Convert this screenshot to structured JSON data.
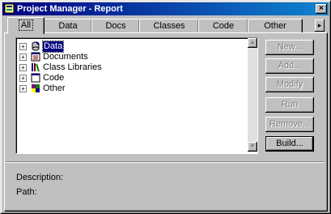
{
  "window": {
    "title": "Project Manager - Report"
  },
  "tabs": [
    {
      "label": "All"
    },
    {
      "label": "Data"
    },
    {
      "label": "Docs"
    },
    {
      "label": "Classes"
    },
    {
      "label": "Code"
    },
    {
      "label": "Other"
    }
  ],
  "tree": {
    "items": [
      {
        "label": "Data",
        "icon": "database-icon",
        "expanded": false,
        "selected": true
      },
      {
        "label": "Documents",
        "icon": "documents-icon",
        "expanded": false,
        "selected": false
      },
      {
        "label": "Class Libraries",
        "icon": "class-libraries-icon",
        "expanded": false,
        "selected": false
      },
      {
        "label": "Code",
        "icon": "code-icon",
        "expanded": false,
        "selected": false
      },
      {
        "label": "Other",
        "icon": "other-icon",
        "expanded": false,
        "selected": false
      }
    ]
  },
  "buttons": {
    "new": "New...",
    "add": "Add...",
    "modify": "Modify",
    "run": "Run",
    "remove": "Remove...",
    "build": "Build..."
  },
  "info": {
    "description_label": "Description:",
    "path_label": "Path:"
  },
  "colors": {
    "titlebar": "#000080",
    "selection": "#000080",
    "face": "#c0c0c0"
  }
}
